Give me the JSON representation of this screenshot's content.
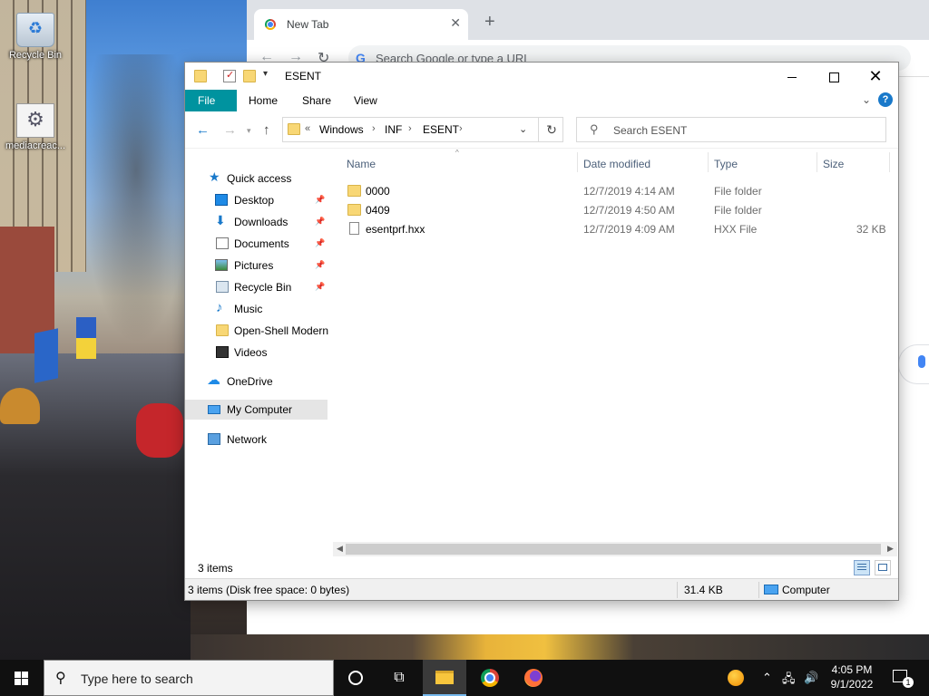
{
  "desktop": {
    "icons": [
      {
        "label": "Recycle Bin",
        "icon": "recycle-bin-icon"
      },
      {
        "label": "mediacreac...",
        "icon": "media-creation-tool-icon"
      }
    ]
  },
  "chrome": {
    "tab_title": "New Tab",
    "tab_close": "✕",
    "new_tab": "+",
    "omnibox_placeholder": "Search Google or type a URL",
    "omnibox_g": "G"
  },
  "explorer": {
    "title": "ESENT",
    "ribbon_tabs": [
      "File",
      "Home",
      "Share",
      "View"
    ],
    "help": "?",
    "address": {
      "overflow": "«",
      "crumbs": [
        "Windows",
        "INF",
        "ESENT"
      ]
    },
    "search_placeholder": "Search ESENT",
    "nav": {
      "quick_access": "Quick access",
      "items": [
        "Desktop",
        "Downloads",
        "Documents",
        "Pictures",
        "Recycle Bin",
        "Music",
        "Open-Shell Modern",
        "Videos"
      ],
      "onedrive": "OneDrive",
      "my_computer": "My Computer",
      "network": "Network"
    },
    "columns": [
      "Name",
      "Date modified",
      "Type",
      "Size"
    ],
    "files": [
      {
        "name": "0000",
        "date": "12/7/2019 4:14 AM",
        "type": "File folder",
        "size": ""
      },
      {
        "name": "0409",
        "date": "12/7/2019 4:50 AM",
        "type": "File folder",
        "size": ""
      },
      {
        "name": "esentprf.hxx",
        "date": "12/7/2019 4:09 AM",
        "type": "HXX File",
        "size": "32 KB"
      }
    ],
    "status_count": "3 items",
    "details_bar": {
      "free_space": "3 items (Disk free space: 0 bytes)",
      "total_size": "31.4 KB",
      "location": "Computer"
    }
  },
  "taskbar": {
    "search_placeholder": "Type here to search",
    "clock_time": "4:05 PM",
    "clock_date": "9/1/2022",
    "notification_count": "1"
  }
}
